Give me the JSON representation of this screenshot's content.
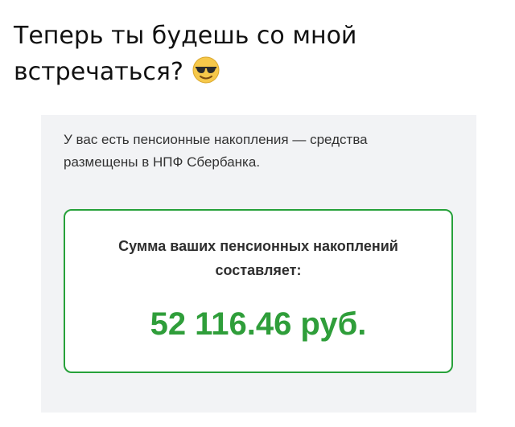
{
  "caption": {
    "line1": "Теперь ты будешь со мной",
    "line2": "встречаться?",
    "emoji": "smiling-face-with-sunglasses"
  },
  "notice": {
    "line1": "У вас есть пенсионные накопления — средства",
    "line2": "размещены в НПФ Сбербанка."
  },
  "savings": {
    "label_line1": "Сумма ваших пенсионных накоплений",
    "label_line2": "составляет:",
    "amount": "52 116.46 руб."
  },
  "colors": {
    "accent_green": "#2f9e3a",
    "card_background": "#f2f3f5"
  }
}
